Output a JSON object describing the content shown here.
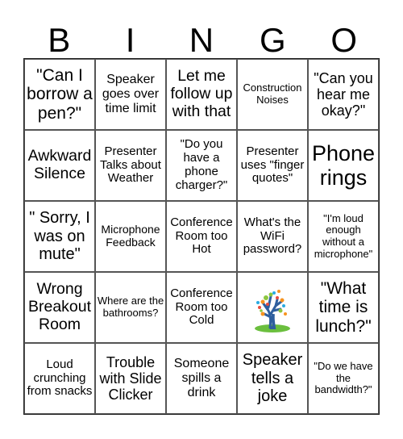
{
  "header": {
    "letters": [
      "B",
      "I",
      "N",
      "G",
      "O"
    ]
  },
  "cells": [
    "\"Can I borrow a pen?\"",
    "Speaker goes over time limit",
    "Let me follow up with that",
    "Construction Noises",
    "\"Can you hear me okay?\"",
    "Awkward Silence",
    "Presenter Talks about Weather",
    "\"Do you have a phone charger?\"",
    "Presenter uses \"finger quotes\"",
    "Phone rings",
    "\" Sorry, I was on mute\"",
    "Microphone Feedback",
    "Conference Room too Hot",
    "What's the WiFi password?",
    "\"I'm loud enough without a microphone\"",
    "Wrong Breakout Room",
    "Where are the bathrooms?",
    "Conference Room too Cold",
    "",
    "\"What time is lunch?\"",
    "Loud crunching from snacks",
    "Trouble with Slide Clicker",
    "Someone spills a drink",
    "Speaker tells a joke",
    "\"Do we have the bandwidth?\""
  ],
  "free_space": {
    "icon": "tree-icon"
  }
}
